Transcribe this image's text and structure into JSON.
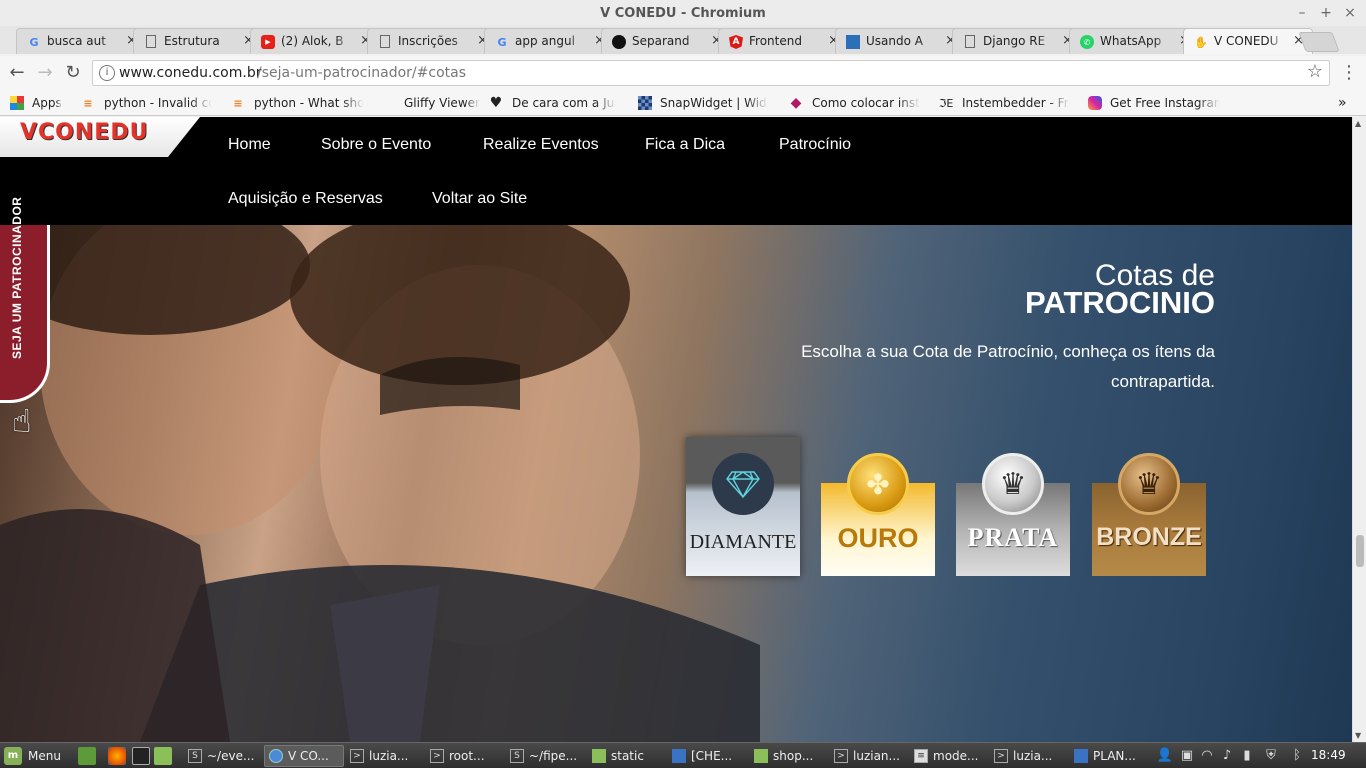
{
  "window": {
    "title": "V CONEDU - Chromium",
    "minimize": "–",
    "maximize": "+",
    "close": "×"
  },
  "tabs": [
    {
      "label": "busca aut",
      "icon": "google-icon",
      "color": "#4285f4"
    },
    {
      "label": "Estrutura",
      "icon": "page-icon",
      "color": "#666666"
    },
    {
      "label": "(2) Alok, B",
      "icon": "youtube-icon",
      "color": "#e62117"
    },
    {
      "label": "Inscrições",
      "icon": "page-icon",
      "color": "#666666"
    },
    {
      "label": "app angul",
      "icon": "google-icon",
      "color": "#4285f4"
    },
    {
      "label": "Separand",
      "icon": "github-icon",
      "color": "#111111"
    },
    {
      "label": "Frontend",
      "icon": "angular-icon",
      "color": "#dd1b16"
    },
    {
      "label": "Usando A",
      "icon": "cube-icon",
      "color": "#2a6fb8"
    },
    {
      "label": "Django RE",
      "icon": "page-icon",
      "color": "#666666"
    },
    {
      "label": "WhatsApp",
      "icon": "whatsapp-icon",
      "color": "#25d366"
    },
    {
      "label": "V CONEDU",
      "icon": "conedu-favicon-icon",
      "color": "#caa055"
    }
  ],
  "tab_close": "×",
  "address": {
    "host": "www.conedu.com.br",
    "path": "/seja-um-patrocinador/#cotas",
    "info": "i"
  },
  "nav_icons": {
    "back": "←",
    "forward": "→",
    "reload": "↻",
    "star": "☆",
    "menu": "⋮"
  },
  "bookmarks": [
    {
      "label": "Apps",
      "icon": "apps-grid-icon"
    },
    {
      "label": "python - Invalid con",
      "icon": "stackoverflow-icon"
    },
    {
      "label": "python - What shoul",
      "icon": "stackoverflow-icon"
    },
    {
      "label": "Gliffy Viewer",
      "icon": "blank-page-icon"
    },
    {
      "label": "De cara com a Juh:",
      "icon": "heart-icon"
    },
    {
      "label": "SnapWidget | Widg",
      "icon": "snapwidget-icon"
    },
    {
      "label": "Como colocar insta",
      "icon": "gem-icon"
    },
    {
      "label": "Instembedder - Fre",
      "icon": "instembedder-icon"
    },
    {
      "label": "Get Free Instagram",
      "icon": "instagram-icon"
    }
  ],
  "bookmarks_more": "»",
  "site": {
    "logo_text": "VCONEDU",
    "nav_row1": [
      "Home",
      "Sobre o Evento",
      "Realize Eventos",
      "Fica a Dica",
      "Patrocínio"
    ],
    "nav_row2": [
      "Aquisição e Reservas",
      "Voltar ao Site"
    ],
    "side_tab": "SEJA UM PATROCINADOR",
    "heading_line1": "Cotas de",
    "heading_line2": "PATROCINIO",
    "subtitle": "Escolha a sua Cota de Patrocínio, conheça os ítens da contrapartida.",
    "cards": [
      {
        "label": "DIAMANTE",
        "icon": "diamond-icon"
      },
      {
        "label": "OURO",
        "icon": "clover-icon"
      },
      {
        "label": "PRATA",
        "icon": "crown-icon"
      },
      {
        "label": "BRONZE",
        "icon": "crown-icon"
      }
    ]
  },
  "taskbar": {
    "menu_label": "Menu",
    "tasks": [
      "~/eve...",
      "V CO...",
      "luzia...",
      "root...",
      "~/fipe...",
      "static",
      "[CHE...",
      "shop...",
      "luzian...",
      "mode...",
      "luzia...",
      "PLAN..."
    ],
    "clock": "18:49"
  }
}
